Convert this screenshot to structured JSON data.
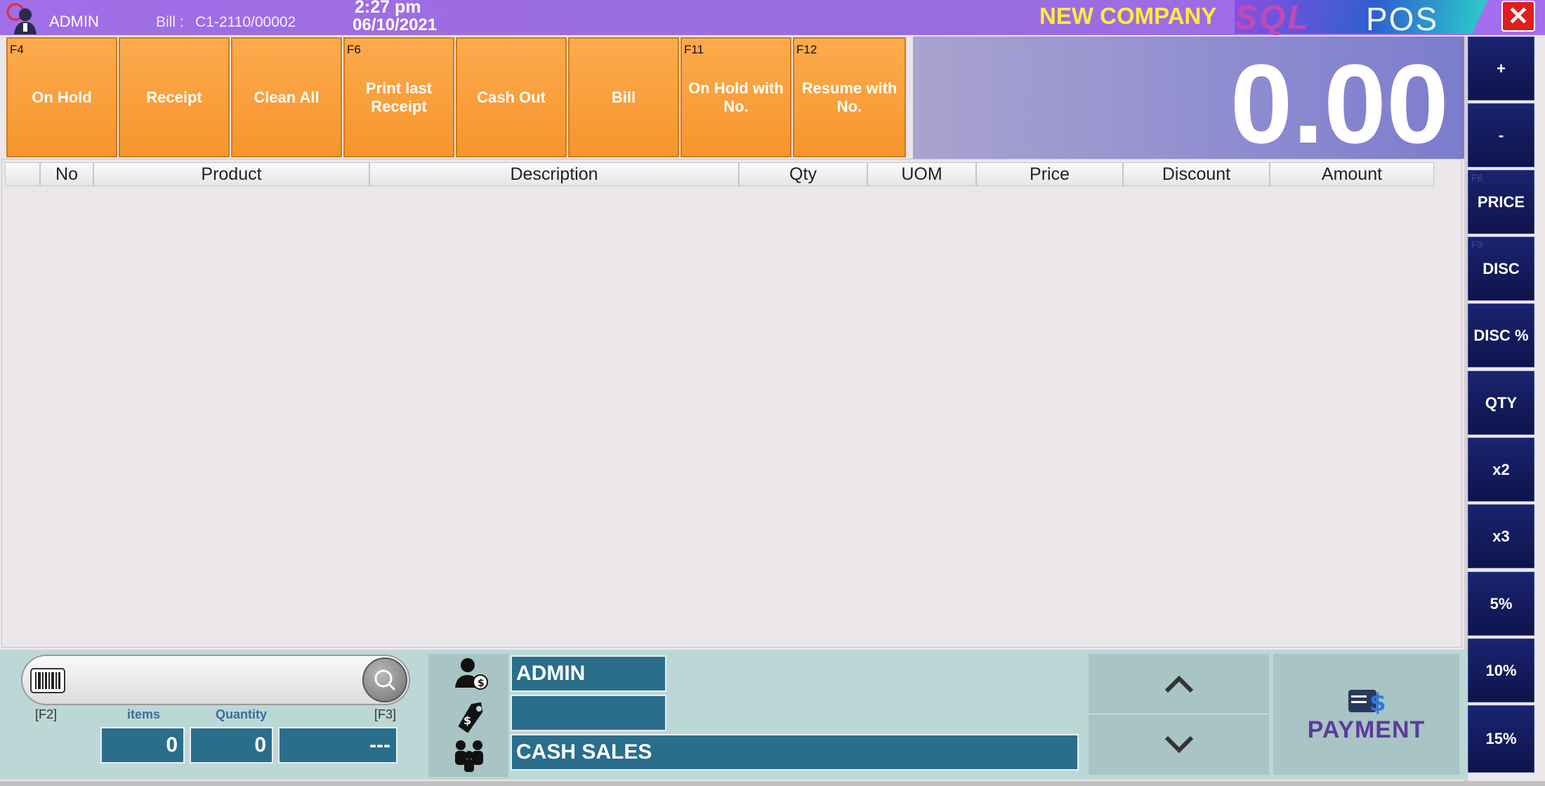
{
  "titlebar": {
    "user": "ADMIN",
    "bill_label": "Bill :",
    "bill_no": "C1-2110/00002",
    "time": "2:27 pm",
    "date": "06/10/2021",
    "company": "NEW COMPANY",
    "brand_sql": "SQL",
    "brand_pos": "POS",
    "close": "✕"
  },
  "function_buttons": [
    {
      "key": "F4",
      "label": "On Hold"
    },
    {
      "key": "",
      "label": "Receipt"
    },
    {
      "key": "",
      "label": "Clean All"
    },
    {
      "key": "F6",
      "label": "Print last Receipt"
    },
    {
      "key": "",
      "label": "Cash Out"
    },
    {
      "key": "",
      "label": "Bill"
    },
    {
      "key": "F11",
      "label": "On Hold with No."
    },
    {
      "key": "F12",
      "label": "Resume with No."
    }
  ],
  "total": "0.00",
  "side_buttons": [
    {
      "key": "",
      "label": "+"
    },
    {
      "key": "",
      "label": "-"
    },
    {
      "key": "F8",
      "label": "PRICE"
    },
    {
      "key": "F9",
      "label": "DISC"
    },
    {
      "key": "",
      "label": "DISC %"
    },
    {
      "key": "",
      "label": "QTY"
    },
    {
      "key": "",
      "label": "x2"
    },
    {
      "key": "",
      "label": "x3"
    },
    {
      "key": "",
      "label": "5%"
    },
    {
      "key": "",
      "label": "10%"
    },
    {
      "key": "",
      "label": "15%"
    }
  ],
  "grid": {
    "columns": [
      "",
      "No",
      "Product",
      "Description",
      "Qty",
      "UOM",
      "Price",
      "Discount",
      "Amount"
    ]
  },
  "bottom": {
    "search_placeholder": "",
    "f2": "[F2]",
    "f3": "[F3]",
    "items_label": "items",
    "quantity_label": "Quantity",
    "items_value": "0",
    "quantity_value": "0",
    "third_value": "---",
    "user_field": "ADMIN",
    "price_group_field": "",
    "customer_field": "CASH SALES",
    "payment_label": "PAYMENT"
  },
  "colors": {
    "titlebar": "#a06ee6",
    "function_button": "#f7952c",
    "side_button": "#0e144b",
    "field": "#2a6e8c",
    "close": "#e01e1e"
  }
}
